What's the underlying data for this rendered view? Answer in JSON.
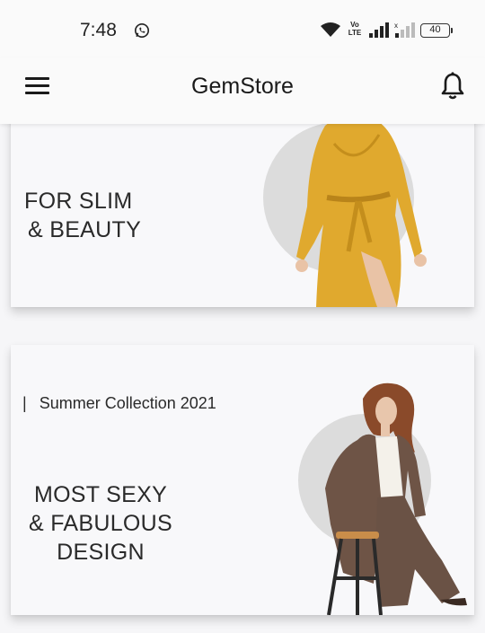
{
  "status_bar": {
    "time": "7:48",
    "volte": [
      "Vo",
      "LTE"
    ],
    "battery": "40"
  },
  "app_bar": {
    "title": "GemStore"
  },
  "banners": [
    {
      "headline_line1": "FOR SLIM",
      "headline_line2": "& BEAUTY",
      "dress_color": "#e0a92e"
    },
    {
      "subtitle_bar": "|",
      "subtitle": "Summer Collection 2021",
      "headline_line1": "MOST SEXY",
      "headline_line2": "& FABULOUS",
      "headline_line3": "DESIGN",
      "coat_color": "#6e5446"
    }
  ],
  "colors": {
    "background": "#f6f6f8",
    "card": "#f8f8fa",
    "circle": "#dcdcdc",
    "text": "#1f1f1f"
  },
  "icons": [
    "whatsapp-icon",
    "wifi-icon",
    "signal-icon",
    "battery-icon",
    "menu-icon",
    "bell-icon"
  ]
}
